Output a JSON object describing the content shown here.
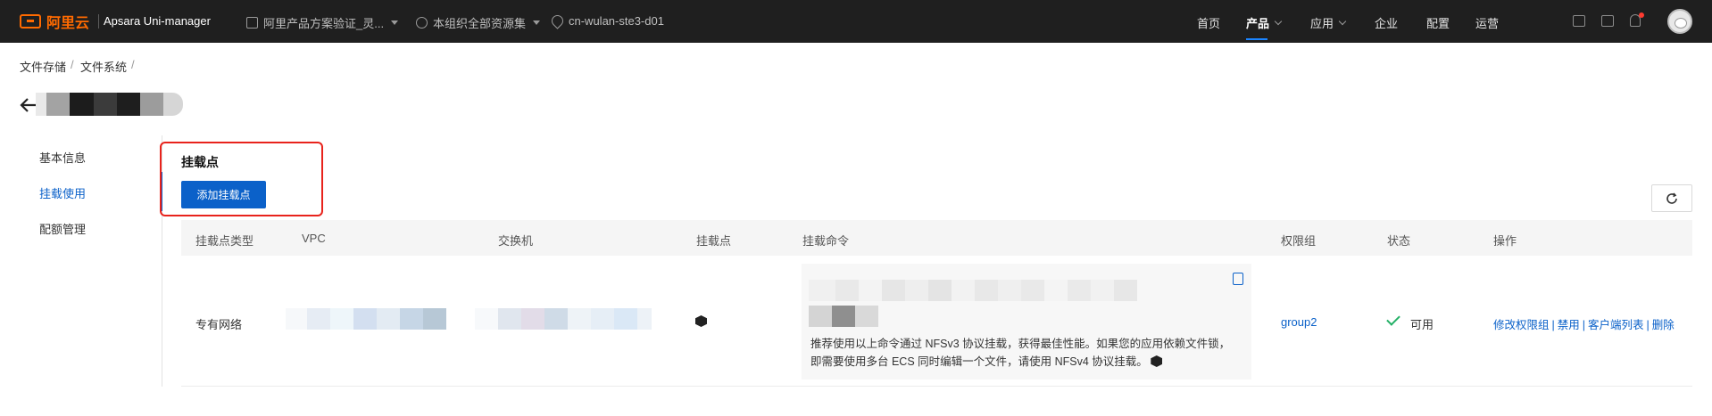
{
  "topbar": {
    "logo_text": "阿里云",
    "product_name": "Apsara Uni-manager",
    "context": [
      {
        "label": "阿里产品方案验证_灵...",
        "icon": "building-icon"
      },
      {
        "label": "本组织全部资源集",
        "icon": "resource-set-icon"
      },
      {
        "label": "cn-wulan-ste3-d01",
        "icon": "location-icon"
      }
    ],
    "nav": [
      {
        "label": "首页",
        "active": false,
        "dropdown": false
      },
      {
        "label": "产品",
        "active": true,
        "dropdown": true
      },
      {
        "label": "应用",
        "active": false,
        "dropdown": true
      },
      {
        "label": "企业",
        "active": false,
        "dropdown": false
      },
      {
        "label": "配置",
        "active": false,
        "dropdown": false
      },
      {
        "label": "运营",
        "active": false,
        "dropdown": false
      }
    ],
    "icons": [
      "screen-icon",
      "book-icon",
      "bell-icon",
      "avatar"
    ]
  },
  "breadcrumb": [
    "文件存储",
    "文件系统"
  ],
  "breadcrumb_sep": "/",
  "sidebar": {
    "items": [
      {
        "label": "基本信息",
        "active": false
      },
      {
        "label": "挂载使用",
        "active": true
      },
      {
        "label": "配额管理",
        "active": false
      }
    ]
  },
  "section": {
    "title": "挂载点",
    "add_button": "添加挂载点"
  },
  "table": {
    "columns": [
      "挂载点类型",
      "VPC",
      "交换机",
      "挂载点",
      "挂载命令",
      "权限组",
      "状态",
      "操作"
    ],
    "rows": [
      {
        "type": "专有网络",
        "command_note": "推荐使用以上命令通过 NFSv3 协议挂载，获得最佳性能。如果您的应用依赖文件锁，即需要使用多台 ECS 同时编辑一个文件，请使用 NFSv4 协议挂载。",
        "permission_group": "group2",
        "status": "可用",
        "actions": [
          "修改权限组",
          "禁用",
          "客户端列表",
          "删除"
        ]
      }
    ]
  },
  "colors": {
    "accent": "#0b61c9",
    "topbar_bg": "#1f1f1f",
    "logo": "#ff6a00",
    "highlight_box": "#e8231c",
    "status_ok": "#23b066"
  }
}
